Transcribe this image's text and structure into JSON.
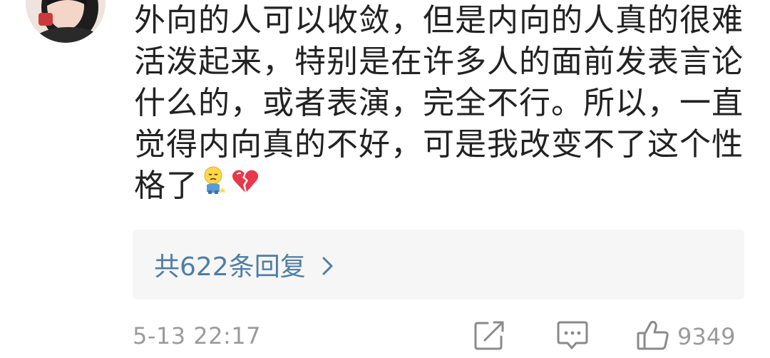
{
  "comment": {
    "lines": [
      "外向的人可以收敛，但是内向的人真的很难",
      "活泼起来，特别是在许多人的面前发表言论",
      "什么的，或者表演，完全不行。所以，一直",
      "觉得内向真的不好，可是我改变不了这个性",
      "格了"
    ],
    "emojis": [
      "sad-face-emoji",
      "broken-heart-emoji"
    ]
  },
  "replies": {
    "label": "共622条回复"
  },
  "footer": {
    "timestamp": "5-13 22:17",
    "like_count": "9349"
  },
  "colors": {
    "text": "#222222",
    "link": "#4e7ea3",
    "muted": "#9b9b9b",
    "reply_bg": "#f6f6f6",
    "heart": "#e8384a"
  },
  "icons": {
    "share": "share-icon",
    "comment": "comment-icon",
    "like": "thumbs-up-icon"
  }
}
